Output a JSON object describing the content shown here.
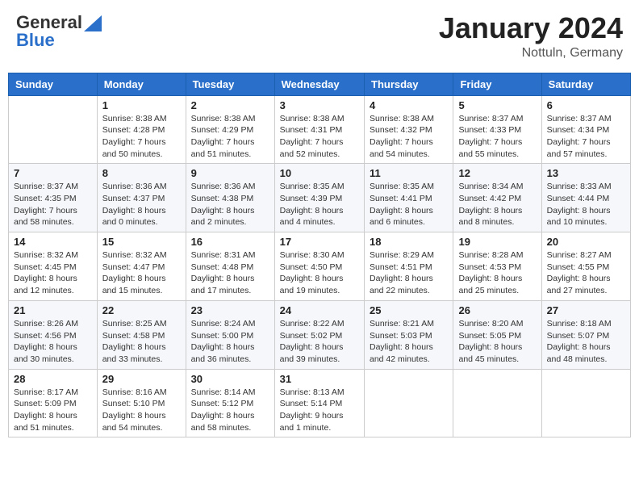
{
  "logo": {
    "general": "General",
    "blue": "Blue"
  },
  "title": {
    "month": "January 2024",
    "location": "Nottuln, Germany"
  },
  "headers": [
    "Sunday",
    "Monday",
    "Tuesday",
    "Wednesday",
    "Thursday",
    "Friday",
    "Saturday"
  ],
  "weeks": [
    [
      {
        "day": "",
        "sunrise": "",
        "sunset": "",
        "daylight": ""
      },
      {
        "day": "1",
        "sunrise": "Sunrise: 8:38 AM",
        "sunset": "Sunset: 4:28 PM",
        "daylight": "Daylight: 7 hours and 50 minutes."
      },
      {
        "day": "2",
        "sunrise": "Sunrise: 8:38 AM",
        "sunset": "Sunset: 4:29 PM",
        "daylight": "Daylight: 7 hours and 51 minutes."
      },
      {
        "day": "3",
        "sunrise": "Sunrise: 8:38 AM",
        "sunset": "Sunset: 4:31 PM",
        "daylight": "Daylight: 7 hours and 52 minutes."
      },
      {
        "day": "4",
        "sunrise": "Sunrise: 8:38 AM",
        "sunset": "Sunset: 4:32 PM",
        "daylight": "Daylight: 7 hours and 54 minutes."
      },
      {
        "day": "5",
        "sunrise": "Sunrise: 8:37 AM",
        "sunset": "Sunset: 4:33 PM",
        "daylight": "Daylight: 7 hours and 55 minutes."
      },
      {
        "day": "6",
        "sunrise": "Sunrise: 8:37 AM",
        "sunset": "Sunset: 4:34 PM",
        "daylight": "Daylight: 7 hours and 57 minutes."
      }
    ],
    [
      {
        "day": "7",
        "sunrise": "Sunrise: 8:37 AM",
        "sunset": "Sunset: 4:35 PM",
        "daylight": "Daylight: 7 hours and 58 minutes."
      },
      {
        "day": "8",
        "sunrise": "Sunrise: 8:36 AM",
        "sunset": "Sunset: 4:37 PM",
        "daylight": "Daylight: 8 hours and 0 minutes."
      },
      {
        "day": "9",
        "sunrise": "Sunrise: 8:36 AM",
        "sunset": "Sunset: 4:38 PM",
        "daylight": "Daylight: 8 hours and 2 minutes."
      },
      {
        "day": "10",
        "sunrise": "Sunrise: 8:35 AM",
        "sunset": "Sunset: 4:39 PM",
        "daylight": "Daylight: 8 hours and 4 minutes."
      },
      {
        "day": "11",
        "sunrise": "Sunrise: 8:35 AM",
        "sunset": "Sunset: 4:41 PM",
        "daylight": "Daylight: 8 hours and 6 minutes."
      },
      {
        "day": "12",
        "sunrise": "Sunrise: 8:34 AM",
        "sunset": "Sunset: 4:42 PM",
        "daylight": "Daylight: 8 hours and 8 minutes."
      },
      {
        "day": "13",
        "sunrise": "Sunrise: 8:33 AM",
        "sunset": "Sunset: 4:44 PM",
        "daylight": "Daylight: 8 hours and 10 minutes."
      }
    ],
    [
      {
        "day": "14",
        "sunrise": "Sunrise: 8:32 AM",
        "sunset": "Sunset: 4:45 PM",
        "daylight": "Daylight: 8 hours and 12 minutes."
      },
      {
        "day": "15",
        "sunrise": "Sunrise: 8:32 AM",
        "sunset": "Sunset: 4:47 PM",
        "daylight": "Daylight: 8 hours and 15 minutes."
      },
      {
        "day": "16",
        "sunrise": "Sunrise: 8:31 AM",
        "sunset": "Sunset: 4:48 PM",
        "daylight": "Daylight: 8 hours and 17 minutes."
      },
      {
        "day": "17",
        "sunrise": "Sunrise: 8:30 AM",
        "sunset": "Sunset: 4:50 PM",
        "daylight": "Daylight: 8 hours and 19 minutes."
      },
      {
        "day": "18",
        "sunrise": "Sunrise: 8:29 AM",
        "sunset": "Sunset: 4:51 PM",
        "daylight": "Daylight: 8 hours and 22 minutes."
      },
      {
        "day": "19",
        "sunrise": "Sunrise: 8:28 AM",
        "sunset": "Sunset: 4:53 PM",
        "daylight": "Daylight: 8 hours and 25 minutes."
      },
      {
        "day": "20",
        "sunrise": "Sunrise: 8:27 AM",
        "sunset": "Sunset: 4:55 PM",
        "daylight": "Daylight: 8 hours and 27 minutes."
      }
    ],
    [
      {
        "day": "21",
        "sunrise": "Sunrise: 8:26 AM",
        "sunset": "Sunset: 4:56 PM",
        "daylight": "Daylight: 8 hours and 30 minutes."
      },
      {
        "day": "22",
        "sunrise": "Sunrise: 8:25 AM",
        "sunset": "Sunset: 4:58 PM",
        "daylight": "Daylight: 8 hours and 33 minutes."
      },
      {
        "day": "23",
        "sunrise": "Sunrise: 8:24 AM",
        "sunset": "Sunset: 5:00 PM",
        "daylight": "Daylight: 8 hours and 36 minutes."
      },
      {
        "day": "24",
        "sunrise": "Sunrise: 8:22 AM",
        "sunset": "Sunset: 5:02 PM",
        "daylight": "Daylight: 8 hours and 39 minutes."
      },
      {
        "day": "25",
        "sunrise": "Sunrise: 8:21 AM",
        "sunset": "Sunset: 5:03 PM",
        "daylight": "Daylight: 8 hours and 42 minutes."
      },
      {
        "day": "26",
        "sunrise": "Sunrise: 8:20 AM",
        "sunset": "Sunset: 5:05 PM",
        "daylight": "Daylight: 8 hours and 45 minutes."
      },
      {
        "day": "27",
        "sunrise": "Sunrise: 8:18 AM",
        "sunset": "Sunset: 5:07 PM",
        "daylight": "Daylight: 8 hours and 48 minutes."
      }
    ],
    [
      {
        "day": "28",
        "sunrise": "Sunrise: 8:17 AM",
        "sunset": "Sunset: 5:09 PM",
        "daylight": "Daylight: 8 hours and 51 minutes."
      },
      {
        "day": "29",
        "sunrise": "Sunrise: 8:16 AM",
        "sunset": "Sunset: 5:10 PM",
        "daylight": "Daylight: 8 hours and 54 minutes."
      },
      {
        "day": "30",
        "sunrise": "Sunrise: 8:14 AM",
        "sunset": "Sunset: 5:12 PM",
        "daylight": "Daylight: 8 hours and 58 minutes."
      },
      {
        "day": "31",
        "sunrise": "Sunrise: 8:13 AM",
        "sunset": "Sunset: 5:14 PM",
        "daylight": "Daylight: 9 hours and 1 minute."
      },
      {
        "day": "",
        "sunrise": "",
        "sunset": "",
        "daylight": ""
      },
      {
        "day": "",
        "sunrise": "",
        "sunset": "",
        "daylight": ""
      },
      {
        "day": "",
        "sunrise": "",
        "sunset": "",
        "daylight": ""
      }
    ]
  ]
}
